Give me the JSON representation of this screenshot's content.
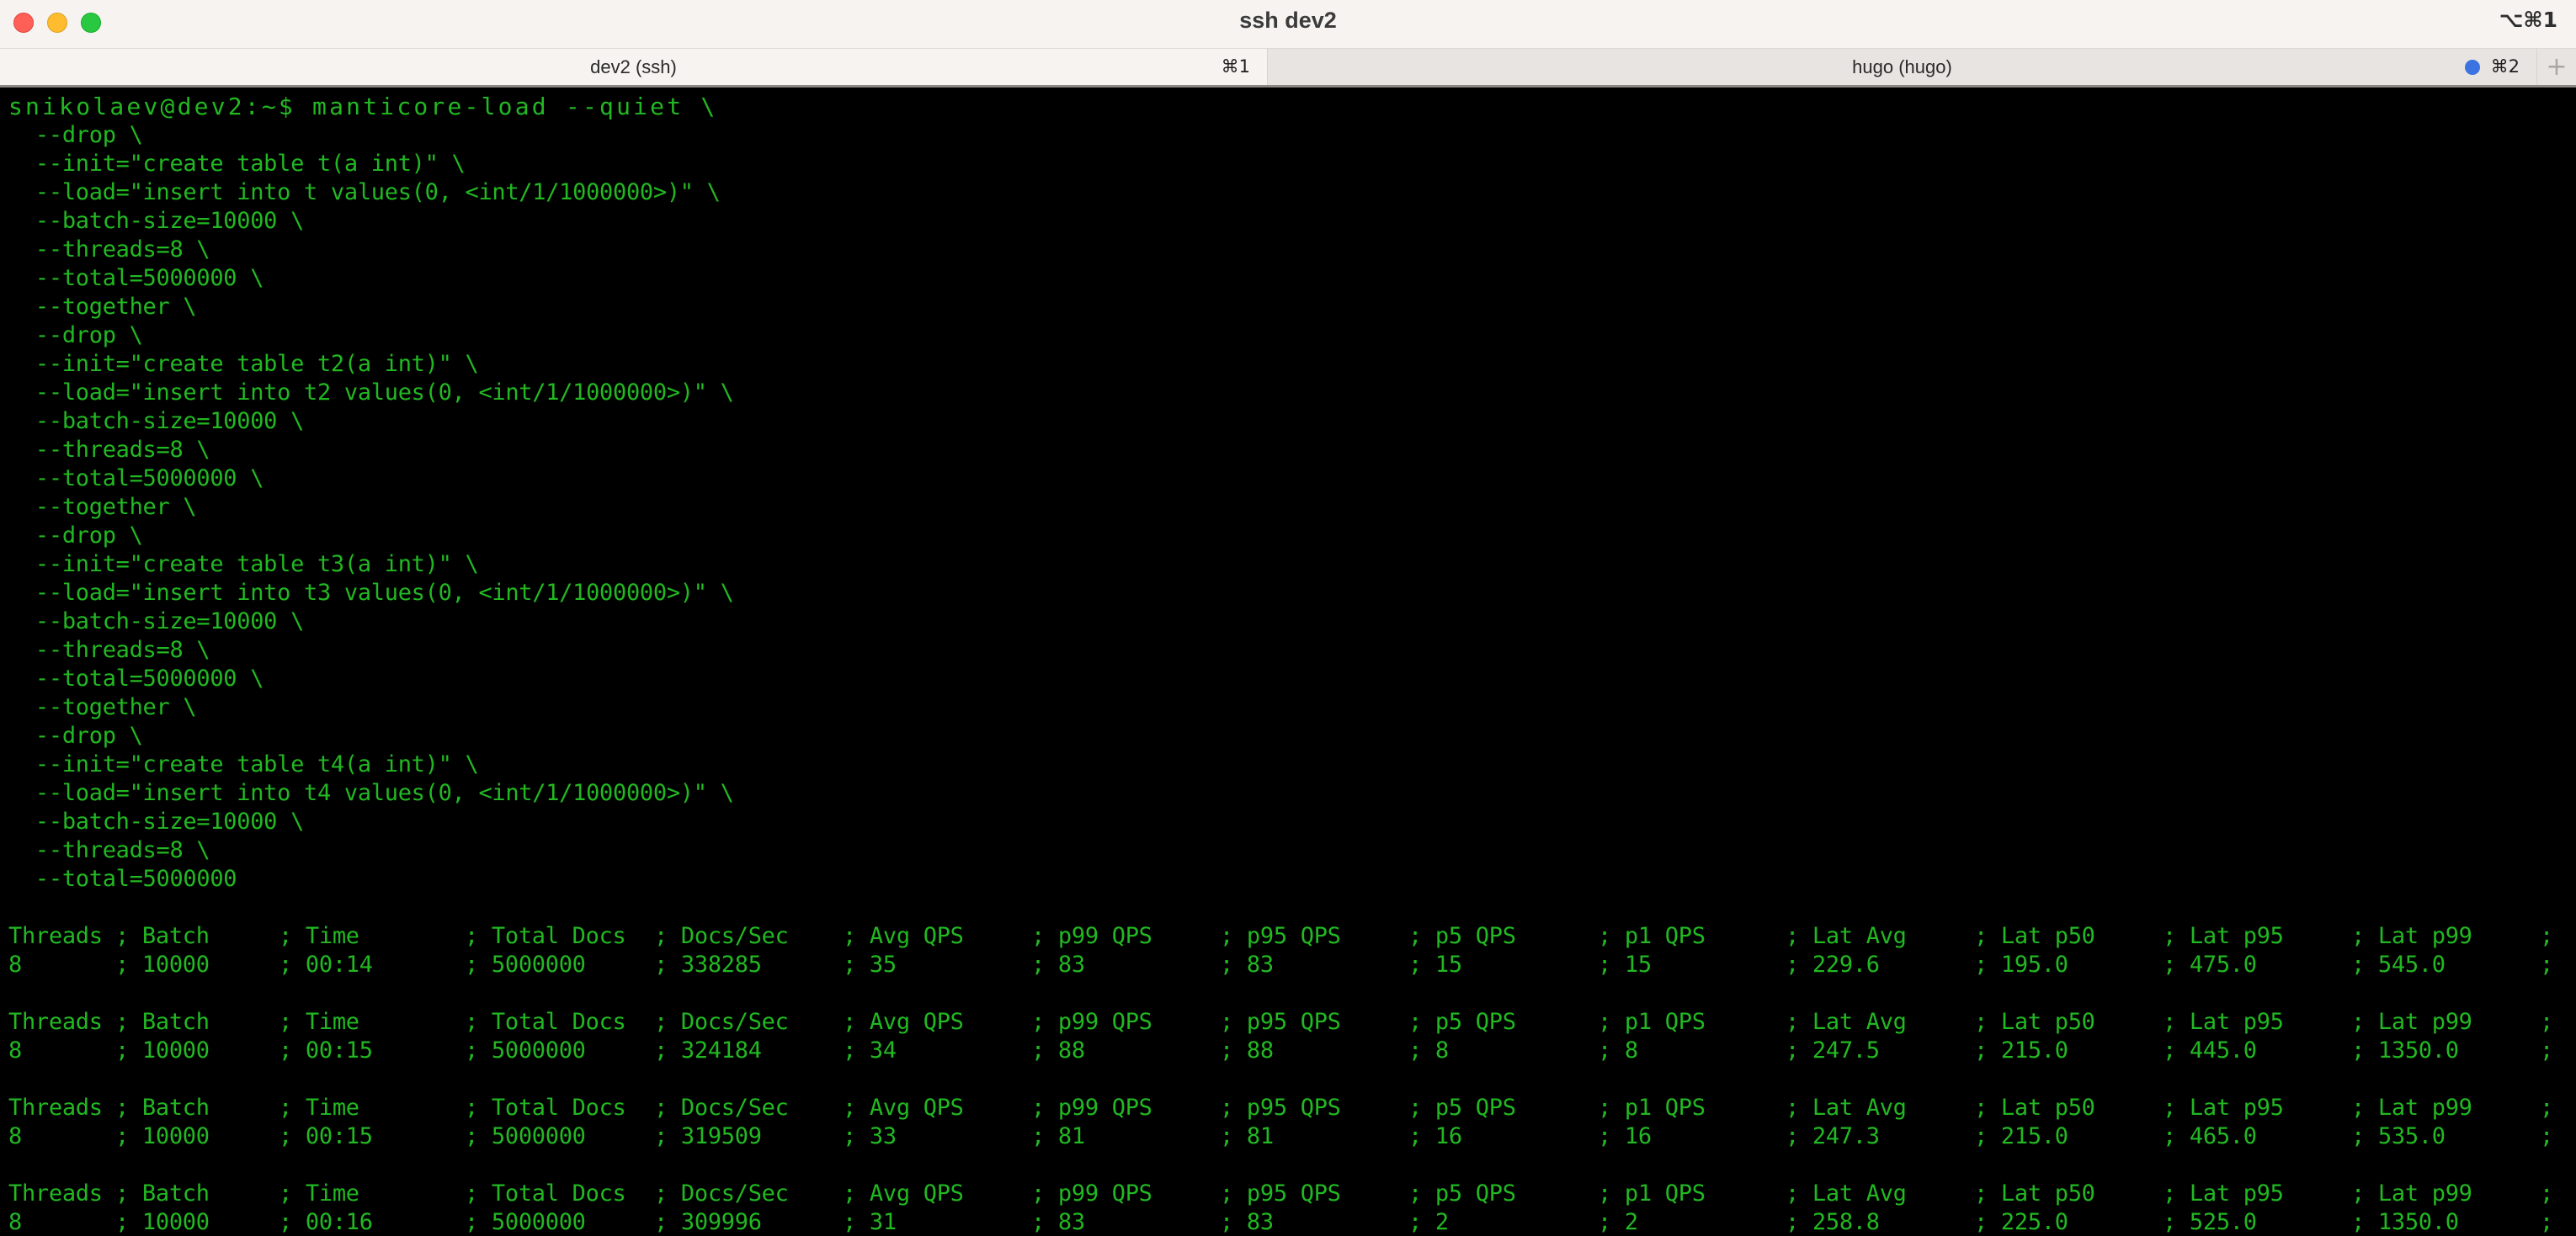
{
  "window": {
    "title": "ssh dev2",
    "shortcut": "⌥⌘1",
    "traffic_lights": [
      "close",
      "minimize",
      "zoom"
    ]
  },
  "tabs": [
    {
      "label": "dev2 (ssh)",
      "shortcut": "⌘1",
      "active": true
    },
    {
      "label": "hugo (hugo)",
      "shortcut": "⌘2",
      "active": false,
      "indicator_color": "#3b73e0"
    }
  ],
  "new_tab_label": "+",
  "colors": {
    "terminal_bg": "#000000",
    "terminal_fg": "#22b822",
    "titlebar_bg": "#f6f3f1",
    "inactive_tab_bg": "#e8e4e1"
  },
  "terminal": {
    "prompt": "snikolaev@dev2:~$ manticore-load --quiet \\",
    "command_lines": [
      "  --drop \\",
      "  --init=\"create table t(a int)\" \\",
      "  --load=\"insert into t values(0, <int/1/1000000>)\" \\",
      "  --batch-size=10000 \\",
      "  --threads=8 \\",
      "  --total=5000000 \\",
      "  --together \\",
      "  --drop \\",
      "  --init=\"create table t2(a int)\" \\",
      "  --load=\"insert into t2 values(0, <int/1/1000000>)\" \\",
      "  --batch-size=10000 \\",
      "  --threads=8 \\",
      "  --total=5000000 \\",
      "  --together \\",
      "  --drop \\",
      "  --init=\"create table t3(a int)\" \\",
      "  --load=\"insert into t3 values(0, <int/1/1000000>)\" \\",
      "  --batch-size=10000 \\",
      "  --threads=8 \\",
      "  --total=5000000 \\",
      "  --together \\",
      "  --drop \\",
      "  --init=\"create table t4(a int)\" \\",
      "  --load=\"insert into t4 values(0, <int/1/1000000>)\" \\",
      "  --batch-size=10000 \\",
      "  --threads=8 \\",
      "  --total=5000000"
    ],
    "results": [
      {
        "headers": [
          "Threads",
          "Batch",
          "Time",
          "Total Docs",
          "Docs/Sec",
          "Avg QPS",
          "p99 QPS",
          "p95 QPS",
          "p5 QPS",
          "p1 QPS",
          "Lat Avg",
          "Lat p50",
          "Lat p95",
          "Lat p99",
          ""
        ],
        "values": [
          "8",
          "10000",
          "00:14",
          "5000000",
          "338285",
          "35",
          "83",
          "83",
          "15",
          "15",
          "229.6",
          "195.0",
          "475.0",
          "545.0",
          ""
        ]
      },
      {
        "headers": [
          "Threads",
          "Batch",
          "Time",
          "Total Docs",
          "Docs/Sec",
          "Avg QPS",
          "p99 QPS",
          "p95 QPS",
          "p5 QPS",
          "p1 QPS",
          "Lat Avg",
          "Lat p50",
          "Lat p95",
          "Lat p99",
          ""
        ],
        "values": [
          "8",
          "10000",
          "00:15",
          "5000000",
          "324184",
          "34",
          "88",
          "88",
          "8",
          "8",
          "247.5",
          "215.0",
          "445.0",
          "1350.0",
          ""
        ]
      },
      {
        "headers": [
          "Threads",
          "Batch",
          "Time",
          "Total Docs",
          "Docs/Sec",
          "Avg QPS",
          "p99 QPS",
          "p95 QPS",
          "p5 QPS",
          "p1 QPS",
          "Lat Avg",
          "Lat p50",
          "Lat p95",
          "Lat p99",
          ""
        ],
        "values": [
          "8",
          "10000",
          "00:15",
          "5000000",
          "319509",
          "33",
          "81",
          "81",
          "16",
          "16",
          "247.3",
          "215.0",
          "465.0",
          "535.0",
          ""
        ]
      },
      {
        "headers": [
          "Threads",
          "Batch",
          "Time",
          "Total Docs",
          "Docs/Sec",
          "Avg QPS",
          "p99 QPS",
          "p95 QPS",
          "p5 QPS",
          "p1 QPS",
          "Lat Avg",
          "Lat p50",
          "Lat p95",
          "Lat p99",
          ""
        ],
        "values": [
          "8",
          "10000",
          "00:16",
          "5000000",
          "309996",
          "31",
          "83",
          "83",
          "2",
          "2",
          "258.8",
          "225.0",
          "525.0",
          "1350.0",
          ""
        ]
      }
    ]
  }
}
